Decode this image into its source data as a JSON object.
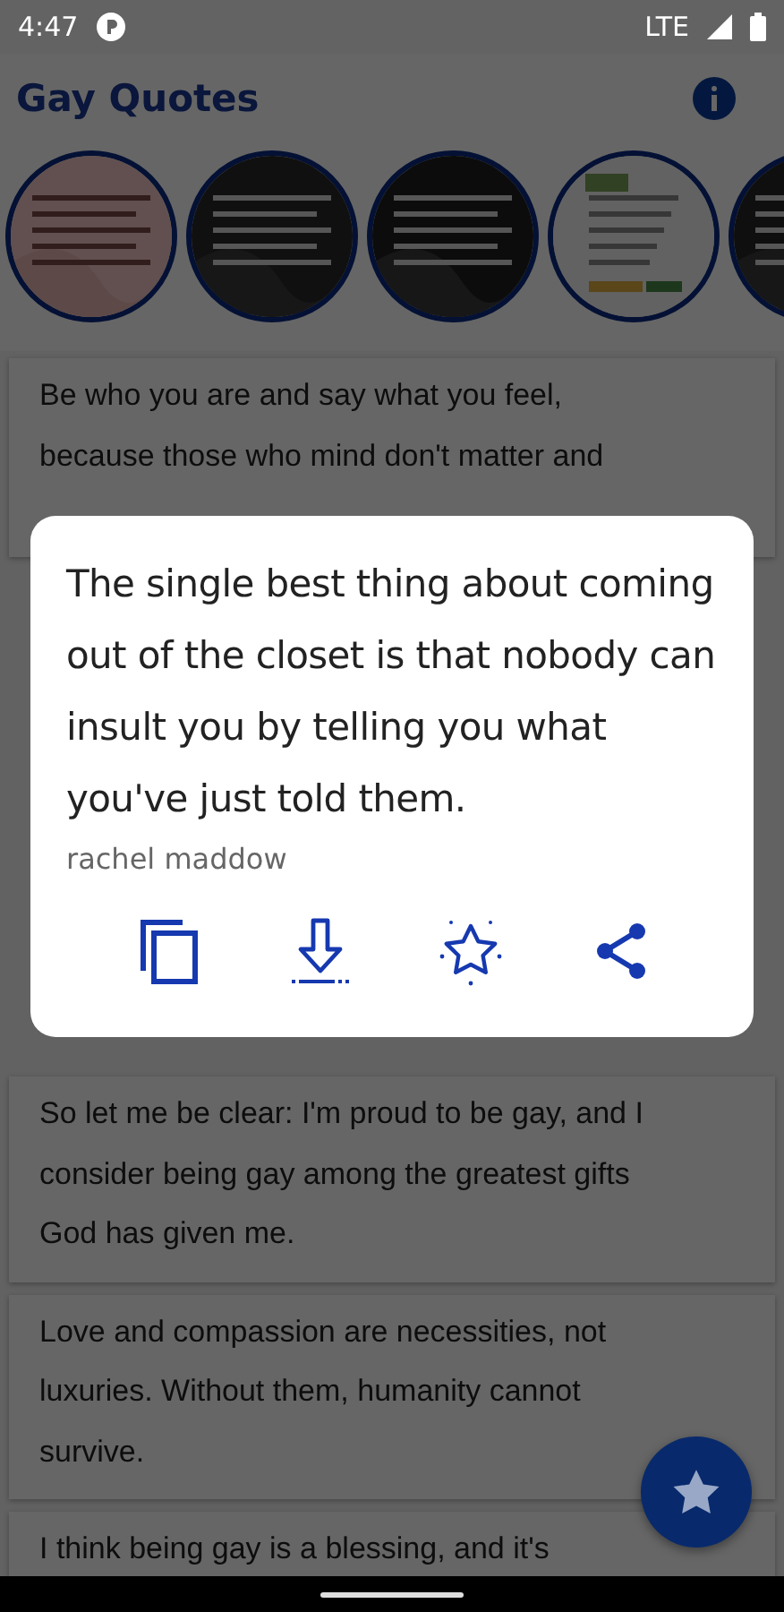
{
  "status_bar": {
    "time": "4:47",
    "network": "LTE"
  },
  "app_bar": {
    "title": "Gay Quotes"
  },
  "quotes_before": [
    {
      "text": "Be who you are and say what you feel, because those who mind don't matter and"
    }
  ],
  "quotes_after": [
    {
      "text": "So let me be clear: I'm proud to be gay, and I consider being gay among the greatest gifts God has given me."
    },
    {
      "text": "Love and compassion are necessities, not luxuries. Without them, humanity cannot survive."
    },
    {
      "text": "I think being gay is a blessing, and it's"
    }
  ],
  "dialog": {
    "quote": "The single best thing about coming out of the closet is that nobody can insult you by telling you what you've just told them.",
    "author": "rachel maddow",
    "actions": [
      {
        "kind": "copy"
      },
      {
        "kind": "download"
      },
      {
        "kind": "favorite"
      },
      {
        "kind": "share"
      }
    ]
  }
}
